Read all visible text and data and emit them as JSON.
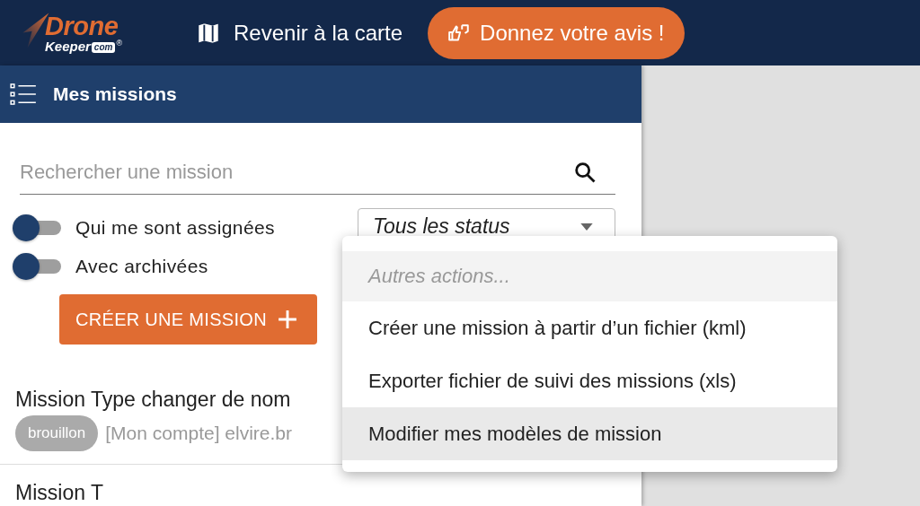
{
  "logo": {
    "primary": "Drone",
    "secondary": "Keeper",
    "suffix": "com",
    "mark": "®"
  },
  "nav": {
    "back_link": "Revenir à la carte",
    "feedback_button": "Donnez votre avis !"
  },
  "panel": {
    "title": "Mes missions"
  },
  "search": {
    "placeholder": "Rechercher une mission"
  },
  "filters": [
    {
      "label": "Qui me sont assignées",
      "checked": false
    },
    {
      "label": "Avec archivées",
      "checked": false
    }
  ],
  "status_select": {
    "value": "Tous les status"
  },
  "create_button": "CRÉER UNE MISSION",
  "menu": [
    {
      "kind": "header",
      "label": "Autres actions..."
    },
    {
      "kind": "item",
      "label": "Créer une mission à partir d’un fichier (kml)",
      "highlighted": false
    },
    {
      "kind": "item",
      "label": "Exporter fichier de suivi des missions (xls)",
      "highlighted": false
    },
    {
      "kind": "item",
      "label": "Modifier mes modèles de mission",
      "highlighted": true
    }
  ],
  "missions": [
    {
      "title": "Mission Type changer de nom",
      "status": "brouillon",
      "owner": "[Mon compte] elvire.br"
    },
    {
      "title": "Mission T"
    }
  ]
}
